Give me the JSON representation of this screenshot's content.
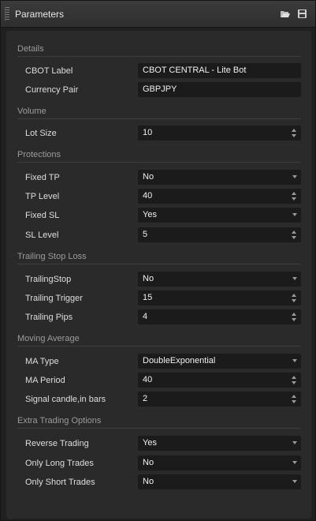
{
  "window": {
    "title": "Parameters"
  },
  "icons": {
    "minimize": "folder-open-icon",
    "save": "save-icon",
    "grip": "drag-grip-icon",
    "dropdown": "chevron-down-icon",
    "stepper": "stepper-arrows-icon"
  },
  "sections": {
    "details": {
      "header": "Details",
      "cbot_label": {
        "label": "CBOT Label",
        "value": "CBOT CENTRAL - Lite Bot"
      },
      "currency_pair": {
        "label": "Currency Pair",
        "value": "GBPJPY"
      }
    },
    "volume": {
      "header": "Volume",
      "lot_size": {
        "label": "Lot Size",
        "value": "10"
      }
    },
    "protections": {
      "header": "Protections",
      "fixed_tp": {
        "label": "Fixed TP",
        "value": "No"
      },
      "tp_level": {
        "label": "TP Level",
        "value": "40"
      },
      "fixed_sl": {
        "label": "Fixed SL",
        "value": "Yes"
      },
      "sl_level": {
        "label": "SL Level",
        "value": "5"
      }
    },
    "trailing": {
      "header": "Trailing Stop Loss",
      "trailing_stop": {
        "label": "TrailingStop",
        "value": "No"
      },
      "trailing_trigger": {
        "label": "Trailing Trigger",
        "value": "15"
      },
      "trailing_pips": {
        "label": "Trailing Pips",
        "value": "4"
      }
    },
    "moving_average": {
      "header": "Moving Average",
      "ma_type": {
        "label": "MA Type",
        "value": "DoubleExponential"
      },
      "ma_period": {
        "label": "MA Period",
        "value": "40"
      },
      "signal_candle": {
        "label": "Signal candle,in bars",
        "value": "2"
      }
    },
    "extra": {
      "header": "Extra Trading Options",
      "reverse_trading": {
        "label": "Reverse Trading",
        "value": "Yes"
      },
      "only_long": {
        "label": "Only Long Trades",
        "value": "No"
      },
      "only_short": {
        "label": "Only Short Trades",
        "value": "No"
      }
    }
  }
}
